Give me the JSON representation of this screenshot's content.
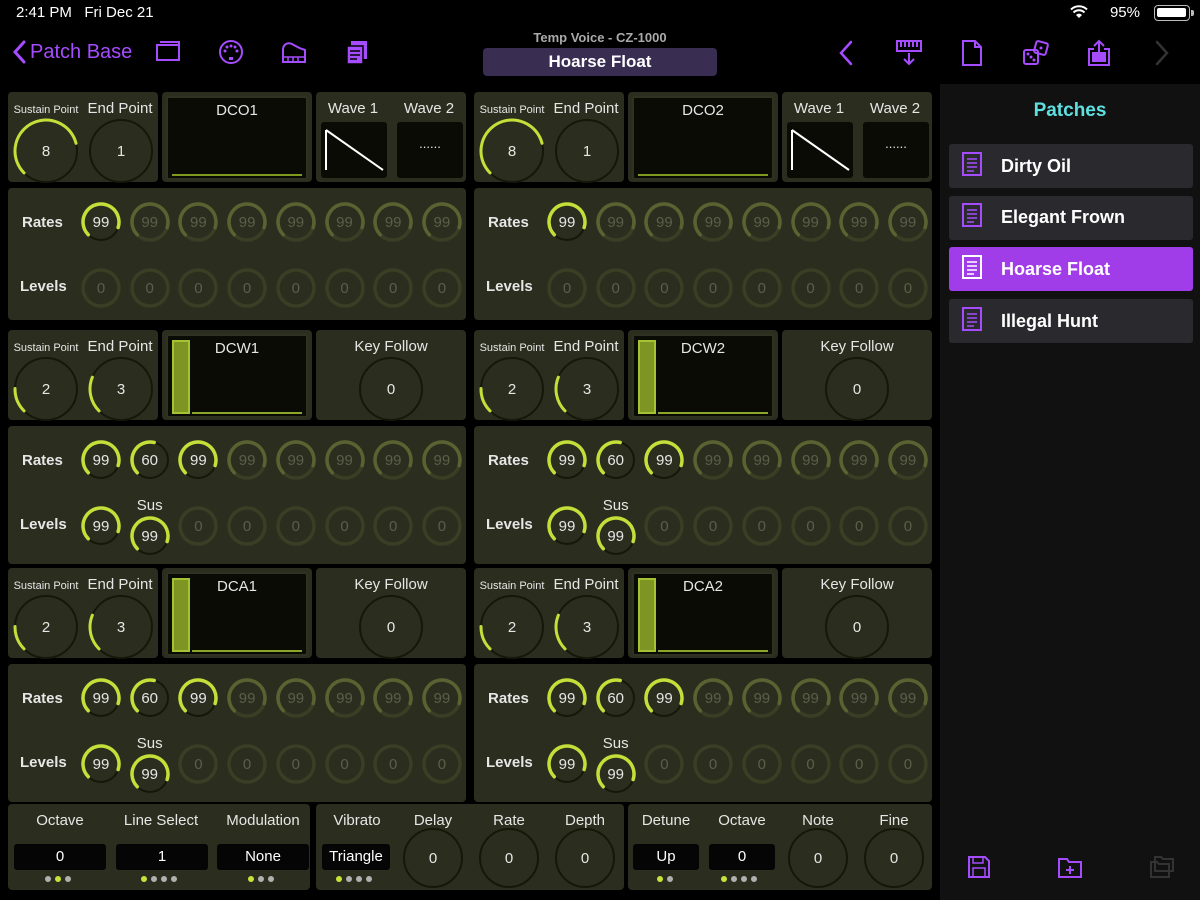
{
  "status": {
    "time": "2:41 PM",
    "date": "Fri Dec 21",
    "battery": "95%"
  },
  "nav": {
    "back_label": "Patch Base",
    "voice_subtitle": "Temp Voice - CZ-1000",
    "voice_title": "Hoarse Float"
  },
  "colors": {
    "accent": "#a64cff",
    "knob_on": "#c5df3a",
    "knob_off": "#5b6232",
    "panel": "#2b2e1e",
    "sidebar_title": "#5fe0e0"
  },
  "labels": {
    "sustain_point": "Sustain Point",
    "end_point": "End Point",
    "wave1": "Wave 1",
    "wave2": "Wave 2",
    "key_follow": "Key Follow",
    "rates": "Rates",
    "levels": "Levels",
    "sus": "Sus"
  },
  "sections": [
    {
      "title": "DCO1",
      "sustain": "8",
      "end": "1",
      "wave_dots": "......"
    },
    {
      "title": "DCO2",
      "sustain": "8",
      "end": "1",
      "wave_dots": "......"
    },
    {
      "title": "DCW1",
      "sustain": "2",
      "end": "3",
      "key_follow": "0"
    },
    {
      "title": "DCW2",
      "sustain": "2",
      "end": "3",
      "key_follow": "0"
    },
    {
      "title": "DCA1",
      "sustain": "2",
      "end": "3",
      "key_follow": "0"
    },
    {
      "title": "DCA2",
      "sustain": "2",
      "end": "3",
      "key_follow": "0"
    }
  ],
  "envelopes": {
    "dco": {
      "rates": [
        "99",
        "99",
        "99",
        "99",
        "99",
        "99",
        "99",
        "99"
      ],
      "levels": [
        "0",
        "0",
        "0",
        "0",
        "0",
        "0",
        "0",
        "0"
      ],
      "active_rates": 1,
      "active_levels": 0,
      "sus_index": -1
    },
    "dcw": {
      "rates": [
        "99",
        "60",
        "99",
        "99",
        "99",
        "99",
        "99",
        "99"
      ],
      "levels": [
        "99",
        "99",
        "0",
        "0",
        "0",
        "0",
        "0",
        "0"
      ],
      "active_rates": 3,
      "active_levels": 2,
      "sus_index": 1
    },
    "dca": {
      "rates": [
        "99",
        "60",
        "99",
        "99",
        "99",
        "99",
        "99",
        "99"
      ],
      "levels": [
        "99",
        "99",
        "0",
        "0",
        "0",
        "0",
        "0",
        "0"
      ],
      "active_rates": 3,
      "active_levels": 2,
      "sus_index": 1
    }
  },
  "bottom": {
    "octave_label": "Octave",
    "octave_value": "0",
    "line_select_label": "Line Select",
    "line_select_value": "1",
    "modulation_label": "Modulation",
    "modulation_value": "None",
    "vibrato_label": "Vibrato",
    "vibrato_value": "Triangle",
    "delay_label": "Delay",
    "delay_value": "0",
    "rate_label": "Rate",
    "rate_value": "0",
    "depth_label": "Depth",
    "depth_value": "0",
    "detune_label": "Detune",
    "detune_value": "Up",
    "octave2_label": "Octave",
    "octave2_value": "0",
    "note_label": "Note",
    "note_value": "0",
    "fine_label": "Fine",
    "fine_value": "0"
  },
  "sidebar": {
    "title": "Patches",
    "patches": [
      "Dirty Oil",
      "Elegant Frown",
      "Hoarse Float",
      "Illegal Hunt"
    ],
    "selected": 2
  }
}
